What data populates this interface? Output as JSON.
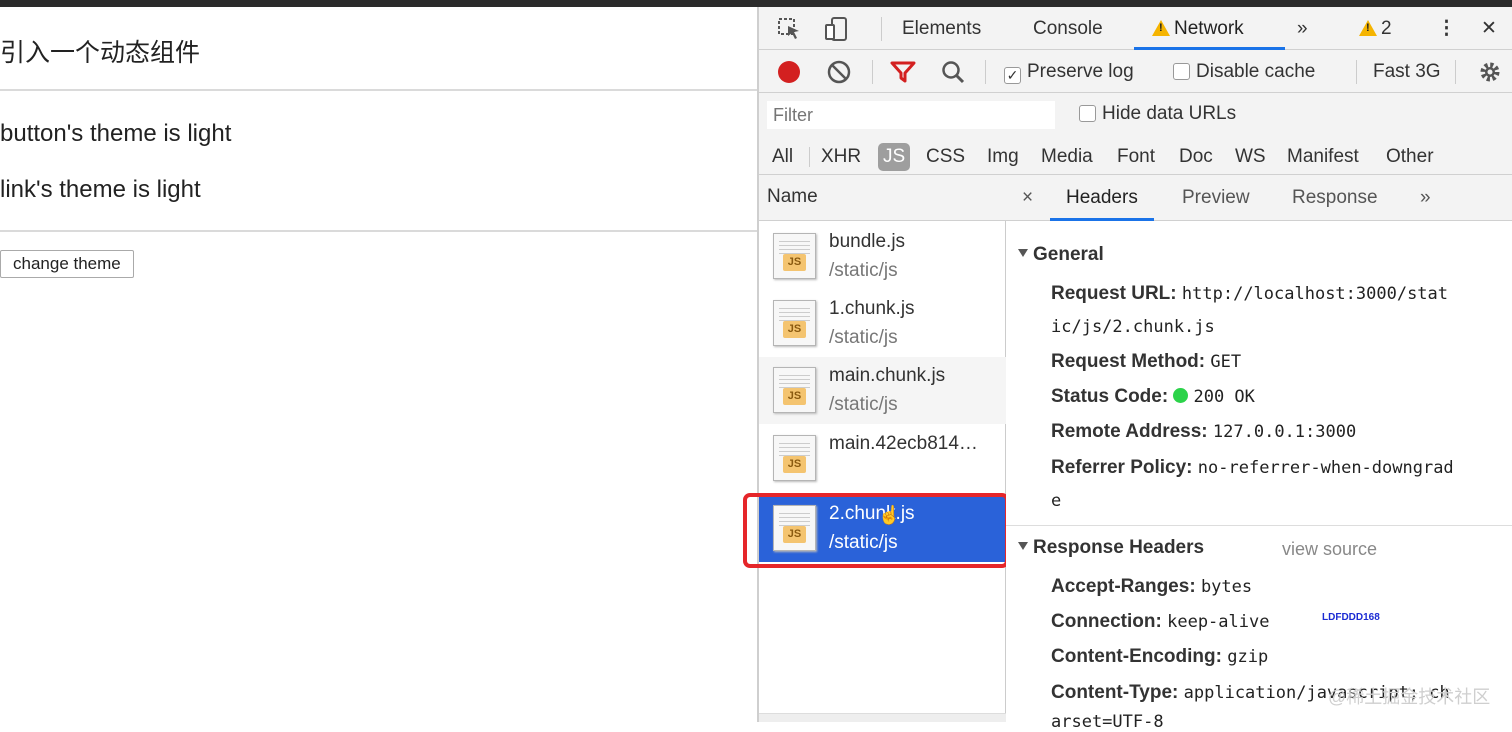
{
  "page": {
    "title": "引入一个动态组件",
    "button_theme": "button's theme is light",
    "link_theme": "link's theme is light",
    "change_button": "change theme"
  },
  "devtools": {
    "tabs": {
      "elements": "Elements",
      "console": "Console",
      "network": "Network",
      "more": "»",
      "warnings": "2",
      "kebab": "⋮",
      "close": "✕"
    },
    "toolbar": {
      "preserve_log": "Preserve log",
      "disable_cache": "Disable cache",
      "throttle": "Fast 3G"
    },
    "filter": {
      "placeholder": "Filter",
      "hide_data_urls": "Hide data URLs"
    },
    "types": [
      "All",
      "XHR",
      "JS",
      "CSS",
      "Img",
      "Media",
      "Font",
      "Doc",
      "WS",
      "Manifest",
      "Other"
    ],
    "name_header": "Name",
    "requests": [
      {
        "name": "bundle.js",
        "path": "/static/js",
        "icon": "js-file-icon"
      },
      {
        "name": "1.chunk.js",
        "path": "/static/js",
        "icon": "js-file-icon"
      },
      {
        "name": "main.chunk.js",
        "path": "/static/js",
        "icon": "js-file-icon"
      },
      {
        "name": "main.42ecb814…",
        "path": "",
        "icon": "js-file-icon"
      },
      {
        "name": "2.chunk.js",
        "path": "/static/js",
        "icon": "js-file-icon",
        "selected": true
      }
    ],
    "detail_tabs": {
      "close": "×",
      "headers": "Headers",
      "preview": "Preview",
      "response": "Response",
      "more": "»"
    },
    "general": {
      "title": "General",
      "request_url_label": "Request URL:",
      "request_url_value": "http://localhost:3000/stat",
      "request_url_cont": "ic/js/2.chunk.js",
      "method_label": "Request Method:",
      "method_value": "GET",
      "status_label": "Status Code:",
      "status_value": "200 OK",
      "remote_label": "Remote Address:",
      "remote_value": "127.0.0.1:3000",
      "referrer_label": "Referrer Policy:",
      "referrer_value": "no-referrer-when-downgrad",
      "referrer_cont": "e"
    },
    "response_headers": {
      "title": "Response Headers",
      "view_source": "view source",
      "accept_ranges_label": "Accept-Ranges:",
      "accept_ranges_value": "bytes",
      "connection_label": "Connection:",
      "connection_value": "keep-alive",
      "stamp": "LDFDDD168",
      "encoding_label": "Content-Encoding:",
      "encoding_value": "gzip",
      "type_label": "Content-Type:",
      "type_value": "application/javascript; ch",
      "type_cont": "arset=UTF-8"
    }
  },
  "watermark": "@稀土掘金技术社区",
  "colors": {
    "accent": "#1a73e8",
    "selected_row": "#2a62d9",
    "highlight_box": "#e5262a",
    "record": "#d32020"
  }
}
